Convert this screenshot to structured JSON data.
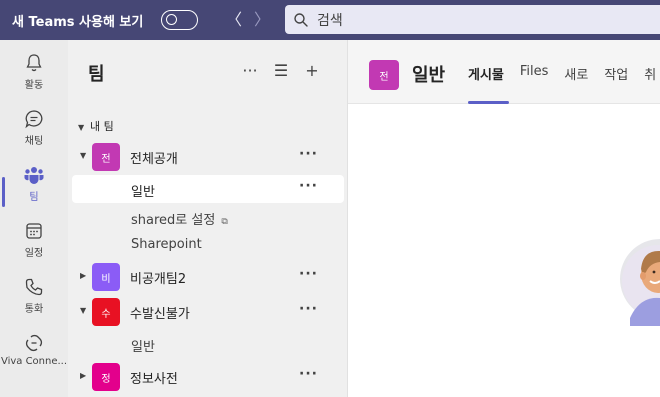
{
  "titlebar": {
    "new_teams_label": "새 Teams 사용해 보기",
    "back_glyph": "〈",
    "forward_glyph": "〉",
    "search_placeholder": "검색"
  },
  "rail": {
    "items": [
      {
        "label": "활동",
        "icon": "bell-icon"
      },
      {
        "label": "채팅",
        "icon": "chat-icon"
      },
      {
        "label": "팀",
        "icon": "teams-icon"
      },
      {
        "label": "일정",
        "icon": "calendar-icon"
      },
      {
        "label": "통화",
        "icon": "phone-icon"
      },
      {
        "label": "Viva Conne...",
        "icon": "viva-icon"
      }
    ],
    "active_index": 2
  },
  "panel": {
    "title": "팀",
    "more_glyph": "···",
    "filter_glyph": "☰",
    "add_glyph": "+",
    "section_label": "내 팀",
    "teams": [
      {
        "name": "전체공개",
        "initial": "전",
        "color": "#c239b3",
        "expanded": true,
        "channels": [
          {
            "name": "일반",
            "selected": true
          },
          {
            "name": "shared로 설정",
            "shared": true
          },
          {
            "name": "Sharepoint"
          }
        ]
      },
      {
        "name": "비공개팀2",
        "initial": "비",
        "color": "#8b5cf6",
        "expanded": false,
        "channels": []
      },
      {
        "name": "수발신불가",
        "initial": "수",
        "color": "#e81123",
        "expanded": true,
        "channels": [
          {
            "name": "일반"
          }
        ]
      },
      {
        "name": "정보사전",
        "initial": "정",
        "color": "#e3008c",
        "expanded": false,
        "channels": []
      }
    ]
  },
  "main": {
    "channel_initial": "전",
    "channel_title": "일반",
    "tabs": [
      "게시물",
      "Files",
      "새로",
      "작업",
      "취"
    ]
  },
  "colors": {
    "titlebar": "#464775",
    "accent": "#5b5fc7"
  }
}
